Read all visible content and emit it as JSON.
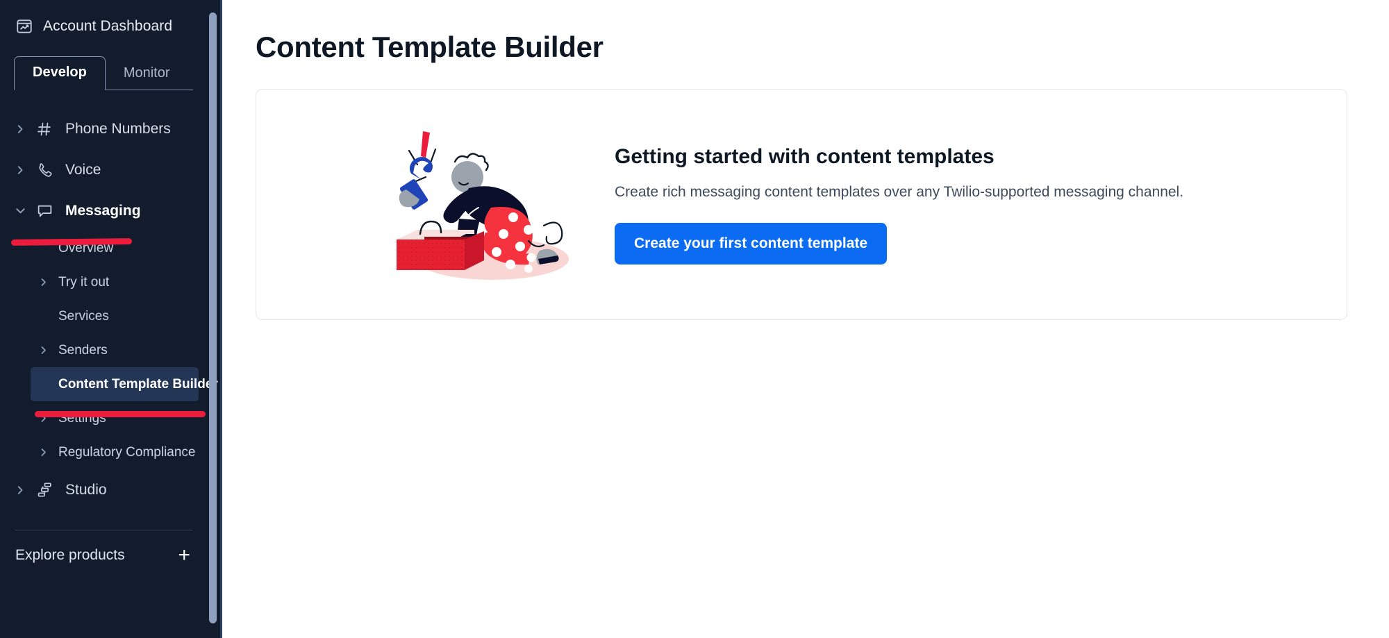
{
  "sidebar": {
    "account": {
      "label": "Account Dashboard",
      "icon": "dashboard-icon"
    },
    "tabs": [
      {
        "label": "Develop",
        "active": true
      },
      {
        "label": "Monitor",
        "active": false
      }
    ],
    "nav": [
      {
        "label": "Phone Numbers",
        "icon": "hash-icon",
        "expandable": true,
        "expanded": false
      },
      {
        "label": "Voice",
        "icon": "phone-icon",
        "expandable": true,
        "expanded": false
      },
      {
        "label": "Messaging",
        "icon": "chat-bubble-icon",
        "expandable": true,
        "expanded": true,
        "annotated": true
      }
    ],
    "messaging_children": [
      {
        "label": "Overview",
        "expandable": false,
        "active": false
      },
      {
        "label": "Try it out",
        "expandable": true,
        "active": false
      },
      {
        "label": "Services",
        "expandable": false,
        "active": false
      },
      {
        "label": "Senders",
        "expandable": true,
        "active": false
      },
      {
        "label": "Content Template Builder",
        "expandable": false,
        "active": true,
        "annotated": true
      },
      {
        "label": "Settings",
        "expandable": true,
        "active": false
      },
      {
        "label": "Regulatory Compliance",
        "expandable": true,
        "active": false
      }
    ],
    "nav_after": [
      {
        "label": "Studio",
        "icon": "studio-icon",
        "expandable": true,
        "expanded": false
      }
    ],
    "explore": {
      "label": "Explore products",
      "icon": "plus-icon"
    }
  },
  "main": {
    "page_title": "Content Template Builder",
    "card": {
      "heading": "Getting started with content templates",
      "description": "Create rich messaging content templates over any Twilio-supported messaging channel.",
      "cta_label": "Create your first content template",
      "illustration": "person-with-wrench-toolbox-illustration"
    }
  },
  "colors": {
    "sidebar_bg": "#121C2D",
    "sidebar_active_item": "#243656",
    "cta_blue": "#0b6bf2",
    "annotation_red": "#ec1c3c",
    "card_border": "#e4e6ea",
    "scrollbar": "#8e9fc0"
  }
}
